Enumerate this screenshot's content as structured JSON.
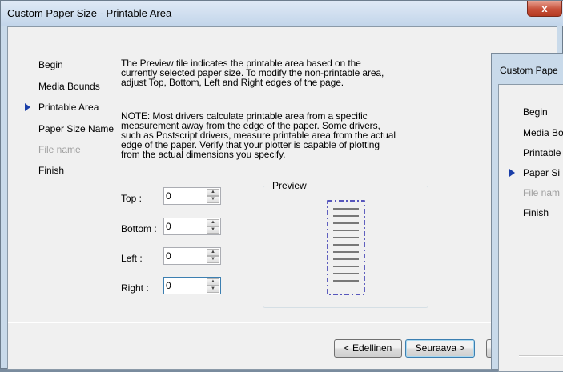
{
  "window": {
    "title": "Custom Paper Size - Printable Area",
    "close_label": "x"
  },
  "nav": {
    "items": [
      {
        "label": "Begin",
        "state": "normal"
      },
      {
        "label": "Media Bounds",
        "state": "normal"
      },
      {
        "label": "Printable Area",
        "state": "current"
      },
      {
        "label": "Paper Size Name",
        "state": "normal"
      },
      {
        "label": "File name",
        "state": "disabled"
      },
      {
        "label": "Finish",
        "state": "normal"
      }
    ]
  },
  "description": {
    "lines": [
      "The Preview tile indicates the printable area based on the",
      "currently selected paper size. To modify the non-printable area,",
      "adjust Top, Bottom, Left and Right edges of the page.",
      "NOTE: Most drivers calculate printable area from a specific",
      "measurement away from the edge of the paper. Some drivers,",
      "such as Postscript drivers, measure printable area from the actual",
      "edge of the paper. Verify that your plotter is capable of plotting",
      "from the actual dimensions you specify."
    ]
  },
  "margins": {
    "top": {
      "label": "Top :",
      "value": "0"
    },
    "bottom": {
      "label": "Bottom :",
      "value": "0"
    },
    "left": {
      "label": "Left :",
      "value": "0"
    },
    "right": {
      "label": "Right :",
      "value": "0"
    }
  },
  "preview": {
    "label": "Preview"
  },
  "buttons": {
    "back": "< Edellinen",
    "next": "Seuraava >"
  },
  "background_window": {
    "title": "Custom Pape",
    "items": [
      {
        "label": "Begin",
        "state": "normal"
      },
      {
        "label": "Media Bo",
        "state": "normal"
      },
      {
        "label": "Printable",
        "state": "normal"
      },
      {
        "label": "Paper Si",
        "state": "current"
      },
      {
        "label": "File nam",
        "state": "disabled"
      },
      {
        "label": "Finish",
        "state": "normal"
      }
    ]
  },
  "colors": {
    "accent": "#1a3ea8",
    "frame": "#c9daea",
    "close": "#c7503a",
    "preview_border": "#2222aa"
  }
}
